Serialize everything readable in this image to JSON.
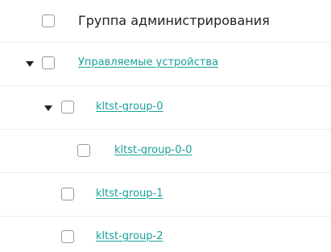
{
  "header": {
    "title": "Группа администрирования"
  },
  "rows": [
    {
      "label": "Управляемые устройства",
      "expanded": true
    },
    {
      "label": "kltst-group-0",
      "expanded": true
    },
    {
      "label": "kltst-group-0-0"
    },
    {
      "label": "kltst-group-1"
    },
    {
      "label": "kltst-group-2"
    }
  ],
  "colors": {
    "link": "#1aa19a",
    "text": "#1f1f1f",
    "checkbox_border": "#9a9a9a",
    "divider": "#ececec"
  }
}
